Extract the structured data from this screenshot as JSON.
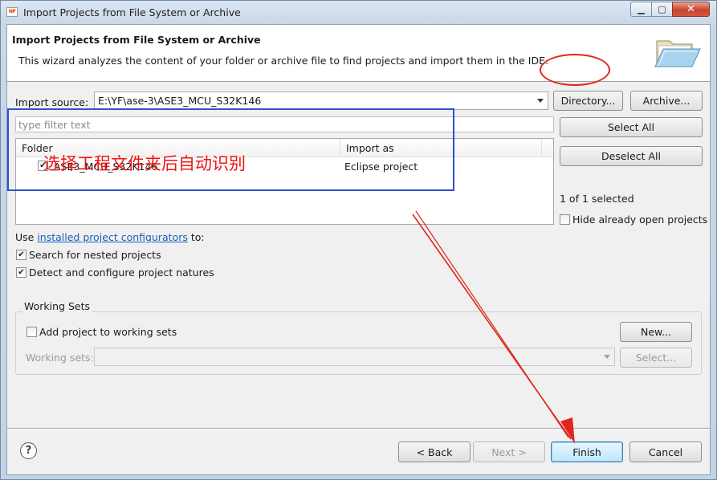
{
  "window": {
    "app_icon_text": "NP",
    "title": "Import Projects from File System or Archive",
    "controls": {
      "minimize": "▁",
      "maximize": "▢",
      "close": "✕"
    }
  },
  "header": {
    "title": "Import Projects from File System or Archive",
    "description": "This wizard analyzes the content of your folder or archive file to find projects and import them in the IDE."
  },
  "import_source": {
    "label": "Import source:",
    "value": "E:\\YF\\ase-3\\ASE3_MCU_S32K146",
    "directory_button": "Directory...",
    "archive_button": "Archive..."
  },
  "filter": {
    "placeholder": "type filter text"
  },
  "table": {
    "columns": [
      "Folder",
      "Import as"
    ],
    "rows": [
      {
        "checked": true,
        "folder": "ASE3_MCU_S32K146",
        "import_as": "Eclipse project"
      }
    ]
  },
  "side_panel": {
    "select_all": "Select All",
    "deselect_all": "Deselect All",
    "selection_status": "1 of 1 selected",
    "hide_open_label": "Hide already open projects",
    "hide_open_checked": false
  },
  "options": {
    "use_prefix": "Use ",
    "configurators_link": "installed project configurators",
    "use_suffix": " to:",
    "search_nested": "Search for nested projects",
    "search_nested_checked": true,
    "detect_natures": "Detect and configure project natures",
    "detect_natures_checked": true
  },
  "working_sets": {
    "group_label": "Working Sets",
    "add_label": "Add project to working sets",
    "add_checked": false,
    "new_button": "New...",
    "sets_label": "Working sets:",
    "select_button": "Select..."
  },
  "footer": {
    "help": "?",
    "back": "< Back",
    "next": "Next >",
    "finish": "Finish",
    "cancel": "Cancel"
  },
  "annotation": {
    "text": "选择工程文件夹后自动识别",
    "color": "#ef1414",
    "box_color": "#2f4fd1"
  }
}
